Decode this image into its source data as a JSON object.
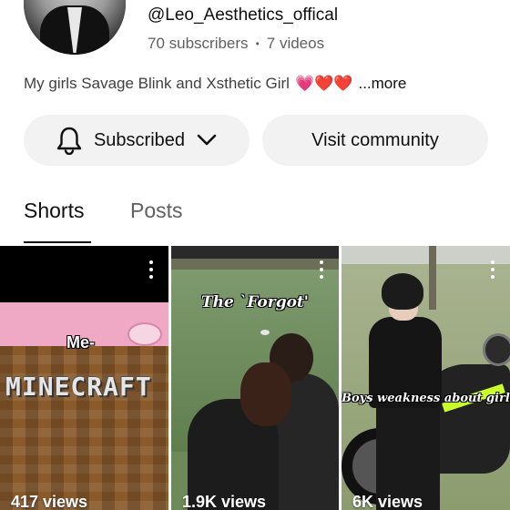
{
  "channel": {
    "handle": "@Leo_Aesthetics_offical",
    "subscribers": "70 subscribers",
    "separator": "•",
    "videos": "7 videos",
    "bio": "My girls  Savage  Blink and Xsthetic Girl",
    "bio_emojis": "💗❤️❤️",
    "bio_more": "...more"
  },
  "actions": {
    "subscribed_label": "Subscribed",
    "visit_label": "Visit community"
  },
  "tabs": [
    {
      "label": "Shorts",
      "active": true
    },
    {
      "label": "Posts",
      "active": false
    }
  ],
  "shorts": [
    {
      "overlay_top": "Me-",
      "overlay_logo": "MINECRAFT",
      "views": "417 views"
    },
    {
      "overlay_caption": "The `Forgot'",
      "views": "1.9K views"
    },
    {
      "overlay_caption": "Boys weakness about girls",
      "views": "6K views"
    }
  ],
  "icons": {
    "bell": "bell-icon",
    "chevron": "chevron-down-icon",
    "kebab": "more-vert-icon"
  },
  "colors": {
    "button_bg": "#f2f2f2",
    "text_primary": "#0f0f0f",
    "text_secondary": "#606060"
  }
}
